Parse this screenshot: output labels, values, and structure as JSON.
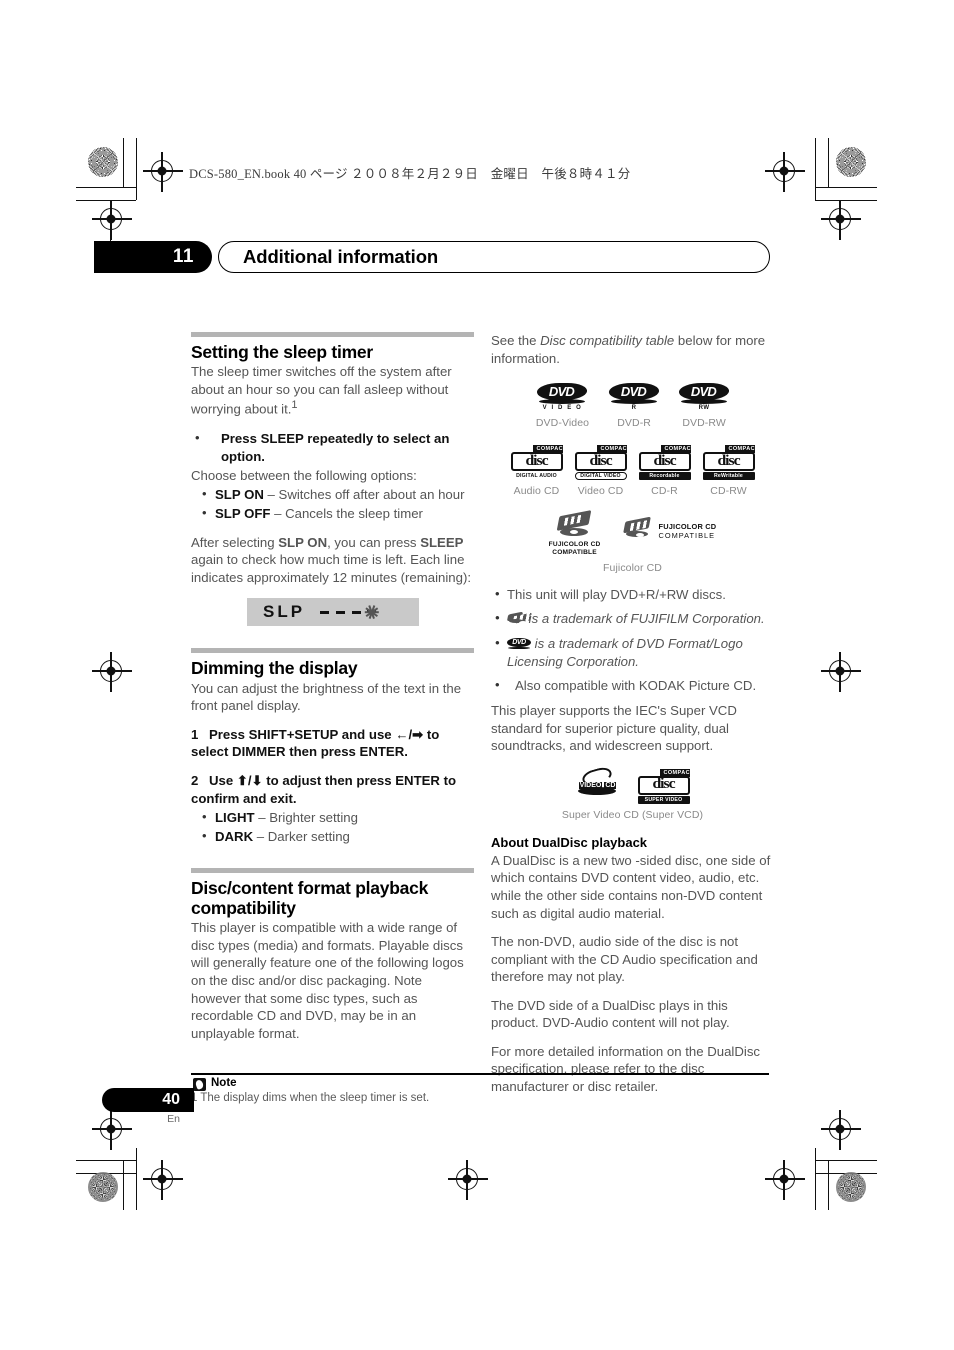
{
  "file_info": "DCS-580_EN.book   40 ページ   ２００８年２月２９日　金曜日　午後８時４１分",
  "chapter": {
    "number": "11",
    "title": "Additional information"
  },
  "left": {
    "sleep": {
      "heading": "Setting the sleep timer",
      "intro": "The sleep timer switches off the system after about an hour so you can fall asleep without worrying about it.",
      "intro_footnote": "1",
      "instruction": "Press SLEEP repeatedly to select an option.",
      "choose": "Choose between the following options:",
      "options": [
        {
          "term": "SLP ON",
          "desc": " – Switches off after about an hour"
        },
        {
          "term": "SLP OFF",
          "desc": " – Cancels the sleep timer"
        }
      ],
      "after_1": "After selecting ",
      "after_b1": "SLP ON",
      "after_2": ", you can press ",
      "after_b2": "SLEEP",
      "after_3": " again to check how much time is left. Each line indicates approximately 12 minutes (remaining):",
      "display": {
        "text": "SLP",
        "dashes": 3,
        "blinking": true
      }
    },
    "dimming": {
      "heading": "Dimming the display",
      "intro": "You can adjust the brightness of the text in the front panel display.",
      "steps": [
        {
          "n": "1",
          "text": "Press SHIFT+SETUP and use ←/➡ to select DIMMER then press ENTER."
        },
        {
          "n": "2",
          "text": "Use ⬆/⬇ to adjust then press ENTER to confirm and exit."
        }
      ],
      "options": [
        {
          "term": "LIGHT",
          "desc": " – Brighter setting"
        },
        {
          "term": "DARK",
          "desc": " – Darker setting"
        }
      ]
    },
    "compat": {
      "heading": "Disc/content format playback compatibility",
      "body": "This player is compatible with a wide range of disc types (media) and formats. Playable discs will generally feature one of the following logos on the disc and/or disc packaging. Note however that some disc types, such as recordable CD and DVD, may be in an unplayable format."
    }
  },
  "right": {
    "see_1": "See the ",
    "see_em": "Disc compatibility table",
    "see_2": " below for more information.",
    "dvd_logos": [
      {
        "icon": "dvd-video-logo",
        "main": "DVD",
        "sub": "V I D E O",
        "caption": "DVD-Video"
      },
      {
        "icon": "dvd-r-logo",
        "main": "DVD",
        "sub": "R",
        "caption": "DVD-R"
      },
      {
        "icon": "dvd-rw-logo",
        "main": "DVD",
        "sub": "RW",
        "caption": "DVD-RW"
      }
    ],
    "cd_logos": [
      {
        "icon": "audio-cd-logo",
        "top": "COMPACT",
        "mid": "disc",
        "bottom": "DIGITAL AUDIO",
        "bottom_style": "plain",
        "caption": "Audio CD"
      },
      {
        "icon": "video-cd-logo",
        "top": "COMPACT",
        "mid": "disc",
        "bottom": "DIGITAL VIDEO",
        "bottom_style": "boxed",
        "caption": "Video CD"
      },
      {
        "icon": "cd-r-logo",
        "top": "COMPACT",
        "mid": "disc",
        "bottom": "Recordable",
        "bottom_style": "inverse",
        "caption": "CD-R"
      },
      {
        "icon": "cd-rw-logo",
        "top": "COMPACT",
        "mid": "disc",
        "bottom": "ReWritable",
        "bottom_style": "inverse",
        "caption": "CD-RW"
      }
    ],
    "fuji_logos": {
      "a_line1": "FUJICOLOR CD",
      "a_line2": "COMPATIBLE",
      "b_line1": "FUJICOLOR CD",
      "b_line2": "COMPATIBLE",
      "caption": "Fujicolor CD"
    },
    "bullets": [
      {
        "kind": "text",
        "text": "This unit will play DVD+R/+RW discs."
      },
      {
        "kind": "fuji",
        "text": " is a trademark of FUJIFILM Corporation."
      },
      {
        "kind": "dvd",
        "text": " is a trademark of DVD Format/Logo Licensing Corporation."
      },
      {
        "kind": "text",
        "text": "Also compatible with KODAK Picture CD."
      }
    ],
    "svcd_para": "This player supports the IEC's Super VCD standard for superior picture quality, dual soundtracks, and widescreen support.",
    "svcd_logos": {
      "video_cd": {
        "word1": "VIDEO",
        "word2": "CD"
      },
      "compact": {
        "top": "COMPACT",
        "mid": "disc",
        "bottom": "SUPER VIDEO"
      },
      "caption": "Super Video CD (Super VCD)"
    },
    "dualdisc": {
      "heading": "About DualDisc playback",
      "paragraphs": [
        "A DualDisc is a new two -sided disc, one side of which contains DVD content video, audio, etc. while the other side contains non-DVD content such as digital audio material.",
        "The non-DVD, audio side of the disc is not compliant with the CD Audio specification and therefore may not play.",
        "The DVD side of a DualDisc plays in this product. DVD-Audio content will not play.",
        "For more detailed information on the DualDisc specification, please refer to the disc manufacturer or disc retailer."
      ]
    }
  },
  "footer": {
    "note_label": "Note",
    "note_text": "1 The display dims when the sleep timer is set.",
    "page_number": "40",
    "language": "En"
  }
}
